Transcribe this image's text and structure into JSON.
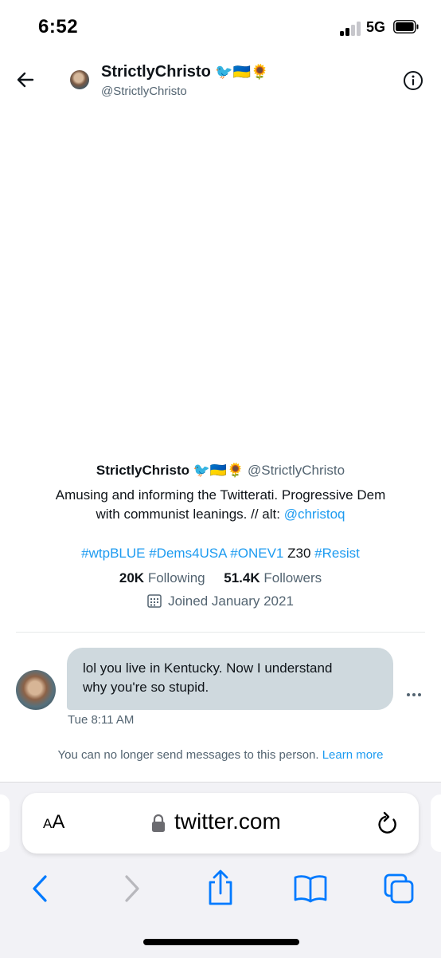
{
  "status_bar": {
    "time": "6:52",
    "network": "5G"
  },
  "header": {
    "name": "StrictlyChristo",
    "badges": "🐦🇺🇦🌻",
    "handle": "@StrictlyChristo"
  },
  "profile": {
    "name": "StrictlyChristo",
    "badges": "🐦🇺🇦🌻",
    "handle": "@StrictlyChristo",
    "bio_line1": "Amusing and informing the Twitterati. Progressive Dem",
    "bio_line2_prefix": "with communist leanings. // alt:",
    "bio_alt_handle": "@christoq",
    "hashtags": [
      "#wtpBLUE",
      "#Dems4USA",
      "#ONEV1"
    ],
    "plain_tag": "Z30",
    "last_hashtag": "#Resist",
    "following_count": "20K",
    "following_label": "Following",
    "followers_count": "51.4K",
    "followers_label": "Followers",
    "joined": "Joined January 2021"
  },
  "message": {
    "line1": "lol you live in Kentucky. Now I understand",
    "line2": "why you're so stupid.",
    "timestamp": "Tue 8:11 AM"
  },
  "notice": {
    "text": "You can no longer send messages to this person.",
    "link": "Learn more"
  },
  "browser": {
    "text_size_label": "AA",
    "url": "twitter.com"
  },
  "colors": {
    "accent": "#1d9bf0",
    "bubble": "#cfd9de",
    "secondary_text": "#536471"
  },
  "icons": [
    "back-arrow-icon",
    "info-icon",
    "calendar-icon",
    "more-icon",
    "lock-icon",
    "reload-icon",
    "back-chevron-icon",
    "forward-chevron-icon",
    "share-icon",
    "bookmarks-icon",
    "tabs-icon"
  ]
}
